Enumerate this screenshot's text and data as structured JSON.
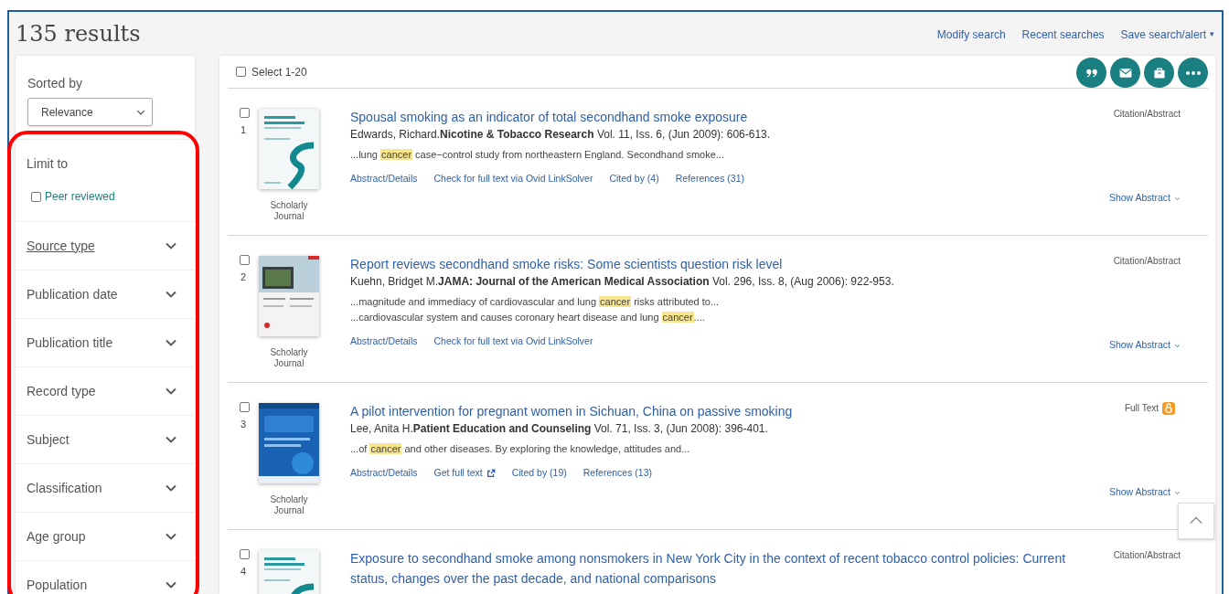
{
  "header": {
    "title": "135 results",
    "links": [
      "Modify search",
      "Recent searches",
      "Save search/alert"
    ],
    "dropdown_caret": "▾"
  },
  "sidebar": {
    "sort_label": "Sorted by",
    "sort_value": "Relevance",
    "limit_label": "Limit to",
    "limit_options": [
      {
        "label": "Peer reviewed",
        "checked": false
      }
    ],
    "filters": [
      {
        "label": "Source type",
        "underlined": true
      },
      {
        "label": "Publication date",
        "underlined": false
      },
      {
        "label": "Publication title",
        "underlined": false
      },
      {
        "label": "Record type",
        "underlined": false
      },
      {
        "label": "Subject",
        "underlined": false
      },
      {
        "label": "Classification",
        "underlined": false
      },
      {
        "label": "Age group",
        "underlined": false
      },
      {
        "label": "Population",
        "underlined": false
      }
    ]
  },
  "toolbar": {
    "select_label": "Select 1-20",
    "select_checked": false,
    "actions": [
      {
        "kind": "cite"
      },
      {
        "kind": "email"
      },
      {
        "kind": "save"
      },
      {
        "kind": "more"
      }
    ]
  },
  "results": [
    {
      "number": "1",
      "checked": false,
      "source_type": "Scholarly Journal",
      "title": "Spousal smoking as an indicator of total secondhand smoke exposure",
      "citation": "Edwards, Richard.**Nicotine & Tobacco Research** Vol. 11, Iss. 6,  (Jun 2009): 606-613.",
      "snippets": [
        [
          {
            "text": "...lung ",
            "highlight": false
          },
          {
            "text": "cancer",
            "highlight": true
          },
          {
            "text": " case−control study from northeastern England. Secondhand smoke...",
            "highlight": false
          }
        ]
      ],
      "links": [
        {
          "label": "Abstract/Details",
          "kind": "plain"
        },
        {
          "label": "Check for full text via Ovid LinkSolver",
          "kind": "plain"
        },
        {
          "label": "Cited by (4)",
          "kind": "plain"
        },
        {
          "label": "References (31)",
          "kind": "plain"
        }
      ],
      "format": {
        "label": "Citation/Abstract",
        "open_access": false
      },
      "show_abstract": "Show Abstract"
    },
    {
      "number": "2",
      "checked": false,
      "source_type": "Scholarly Journal",
      "title": "Report reviews secondhand smoke risks: Some scientists question risk level",
      "citation": "Kuehn, Bridget M.**JAMA: Journal of the American Medical Association** Vol. 296, Iss. 8,  (Aug 2006): 922-953.",
      "snippets": [
        [
          {
            "text": "...magnitude and immediacy of cardiovascular and lung ",
            "highlight": false
          },
          {
            "text": "cancer",
            "highlight": true
          },
          {
            "text": " risks attributed to...",
            "highlight": false
          }
        ],
        [
          {
            "text": "...cardiovascular system and causes coronary heart disease and lung ",
            "highlight": false
          },
          {
            "text": "cancer",
            "highlight": true
          },
          {
            "text": "....",
            "highlight": false
          }
        ]
      ],
      "links": [
        {
          "label": "Abstract/Details",
          "kind": "plain"
        },
        {
          "label": "Check for full text via Ovid LinkSolver",
          "kind": "plain"
        }
      ],
      "format": {
        "label": "Citation/Abstract",
        "open_access": false
      },
      "show_abstract": "Show Abstract"
    },
    {
      "number": "3",
      "checked": false,
      "source_type": "Scholarly Journal",
      "title": "A pilot intervention for pregnant women in Sichuan, China on passive smoking",
      "citation": "Lee, Anita H.**Patient Education and Counseling** Vol. 71, Iss. 3,  (Jun 2008): 396-401.",
      "snippets": [
        [
          {
            "text": "...of ",
            "highlight": false
          },
          {
            "text": "cancer",
            "highlight": true
          },
          {
            "text": " and other diseases. By exploring the knowledge, attitudes and...",
            "highlight": false
          }
        ]
      ],
      "links": [
        {
          "label": "Abstract/Details",
          "kind": "plain"
        },
        {
          "label": "Get full text",
          "kind": "external"
        },
        {
          "label": "Cited by (19)",
          "kind": "plain"
        },
        {
          "label": "References (13)",
          "kind": "plain"
        }
      ],
      "format": {
        "label": "Full Text",
        "open_access": true
      },
      "show_abstract": "Show Abstract"
    },
    {
      "number": "4",
      "checked": false,
      "title": "Exposure to secondhand smoke among nonsmokers in New York City in the context of recent tobacco control policies: Current status, changes over the past decade, and national comparisons",
      "format": {
        "label": "Citation/Abstract",
        "open_access": false
      }
    }
  ]
}
